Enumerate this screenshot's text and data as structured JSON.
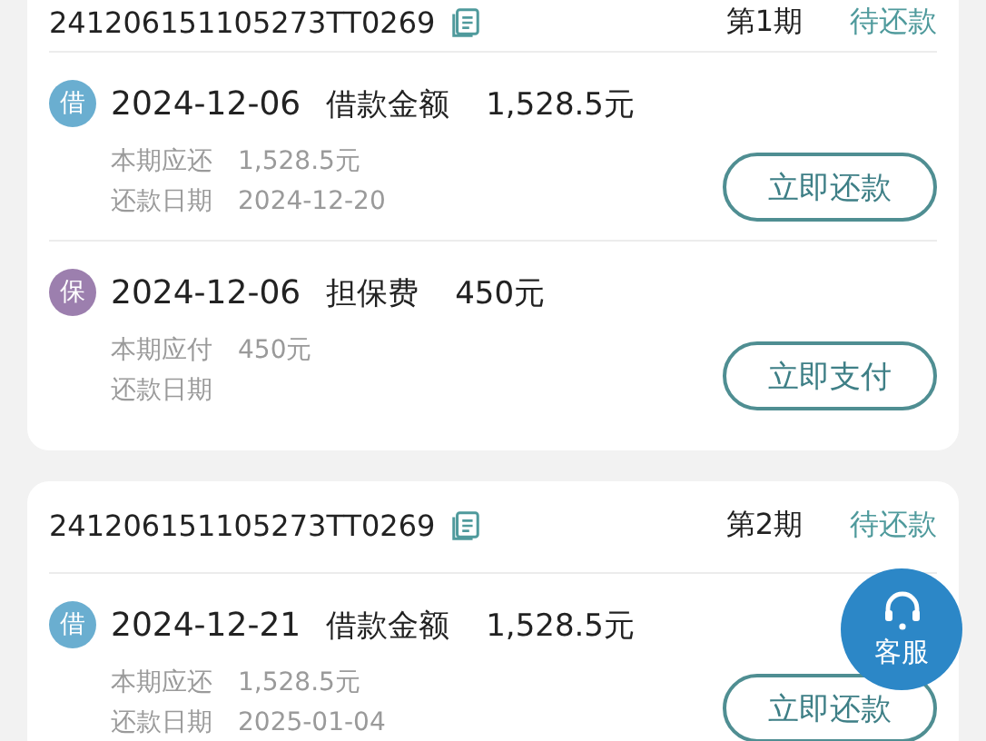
{
  "cards": [
    {
      "header": {
        "order_no": "241206151105273TT0269",
        "period": "第1期",
        "status": "待还款"
      },
      "entries": [
        {
          "kind": "loan",
          "badge": "借",
          "date": "2024-12-06",
          "label": "借款金额",
          "amount": "1,528.5元",
          "details": [
            {
              "label": "本期应还",
              "value": "1,528.5元"
            },
            {
              "label": "还款日期",
              "value": "2024-12-20"
            }
          ],
          "button": "立即还款"
        },
        {
          "kind": "guarantee",
          "badge": "保",
          "date": "2024-12-06",
          "label": "担保费",
          "amount": "450元",
          "details": [
            {
              "label": "本期应付",
              "value": "450元"
            },
            {
              "label": "还款日期"
            }
          ],
          "button": "立即支付"
        }
      ]
    },
    {
      "header": {
        "order_no": "241206151105273TT0269",
        "period": "第2期",
        "status": "待还款"
      },
      "entries": [
        {
          "kind": "loan",
          "badge": "借",
          "date": "2024-12-21",
          "label": "借款金额",
          "amount": "1,528.5元",
          "details": [
            {
              "label": "本期应还",
              "value": "1,528.5元"
            },
            {
              "label": "还款日期",
              "value": "2025-01-04"
            }
          ],
          "button": "立即还款"
        }
      ]
    }
  ],
  "floating_button": {
    "label": "客服"
  }
}
